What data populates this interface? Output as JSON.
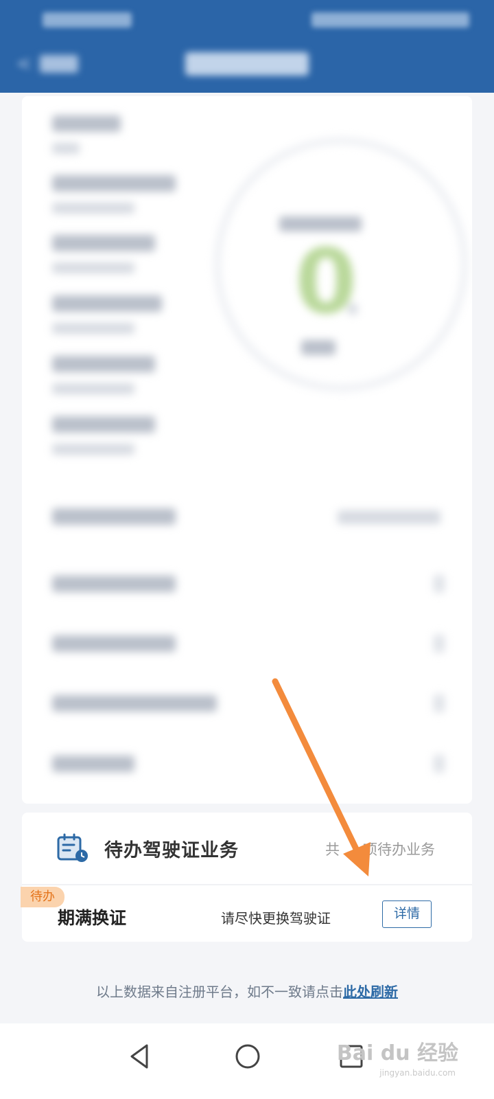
{
  "task_section": {
    "title": "待办驾驶证业务",
    "total_prefix": "共",
    "total_suffix": "项待办业务"
  },
  "task_item": {
    "badge": "待办",
    "name": "期满换证",
    "description": "请尽快更换驾驶证",
    "detail_button": "详情"
  },
  "footer": {
    "text": "以上数据来自注册平台，如不一致请点击",
    "refresh_link": "此处刷新"
  },
  "watermark": {
    "brand": "Bai du 经验",
    "url": "jingyan.baidu.com"
  },
  "colors": {
    "header": "#2b65a8",
    "accent": "#2d6aa6",
    "badge_bg": "#fbd3ad",
    "badge_text": "#e4731a",
    "arrow": "#f38b3c"
  }
}
